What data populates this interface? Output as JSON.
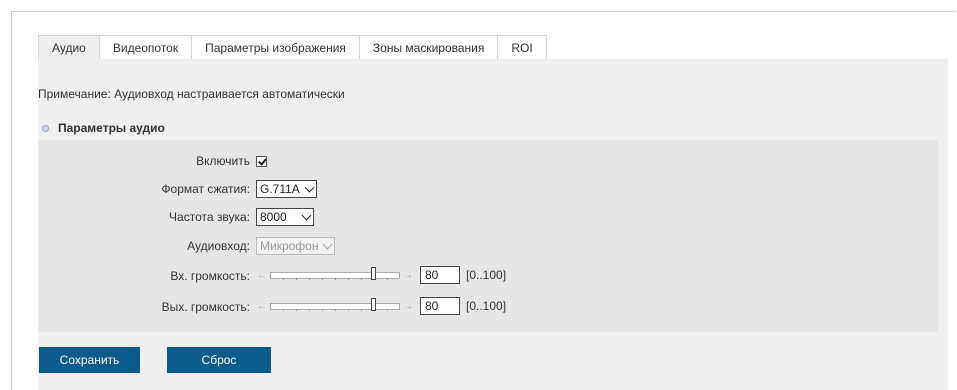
{
  "tabs": [
    "Аудио",
    "Видеопоток",
    "Параметры изображения",
    "Зоны маскирования",
    "ROI"
  ],
  "active_tab": "Аудио",
  "note": "Примечание: Аудиовход настраивается автоматически",
  "section_title": "Параметры аудио",
  "fields": {
    "enable": {
      "label": "Включить",
      "checked": true
    },
    "codec": {
      "label": "Формат сжатия:",
      "value": "G.711A"
    },
    "sample_rate": {
      "label": "Частота звука:",
      "value": "8000"
    },
    "input": {
      "label": "Аудиовход:",
      "value": "Микрофон"
    },
    "input_volume": {
      "label": "Вх. громкость:",
      "value": "80",
      "range": "[0..100]"
    },
    "output_volume": {
      "label": "Вых. громкость:",
      "value": "80",
      "range": "[0..100]"
    }
  },
  "buttons": {
    "save": "Сохранить",
    "reset": "Сброс"
  },
  "colors": {
    "button_bg": "#0b5a8c",
    "panel_bg": "#efefef",
    "inner_bg": "#e6e6e6"
  }
}
